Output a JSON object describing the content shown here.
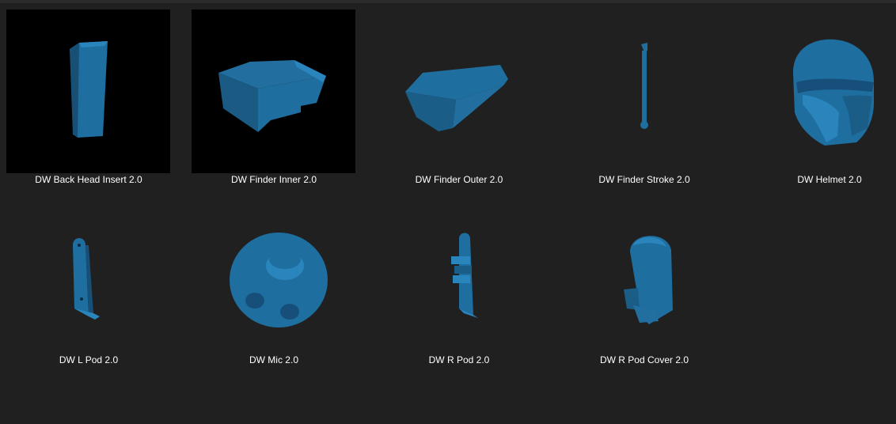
{
  "colors": {
    "background": "#202020",
    "thumbnail_bg": "#000000",
    "model": "#1f6ea0",
    "label": "#ffffff"
  },
  "files": [
    {
      "name": "DW Back Head Insert 2.0",
      "icon": "back-head-insert-model-icon",
      "thumbnail_background": "black"
    },
    {
      "name": "DW Finder Inner 2.0",
      "icon": "finder-inner-model-icon",
      "thumbnail_background": "black"
    },
    {
      "name": "DW Finder Outer 2.0",
      "icon": "finder-outer-model-icon",
      "thumbnail_background": "none"
    },
    {
      "name": "DW Finder Stroke 2.0",
      "icon": "finder-stroke-model-icon",
      "thumbnail_background": "none"
    },
    {
      "name": "DW Helmet 2.0",
      "icon": "helmet-model-icon",
      "thumbnail_background": "none"
    },
    {
      "name": "DW L Pod 2.0",
      "icon": "l-pod-model-icon",
      "thumbnail_background": "none"
    },
    {
      "name": "DW Mic 2.0",
      "icon": "mic-model-icon",
      "thumbnail_background": "none"
    },
    {
      "name": "DW R Pod 2.0",
      "icon": "r-pod-model-icon",
      "thumbnail_background": "none"
    },
    {
      "name": "DW R Pod Cover 2.0",
      "icon": "r-pod-cover-model-icon",
      "thumbnail_background": "none"
    }
  ]
}
